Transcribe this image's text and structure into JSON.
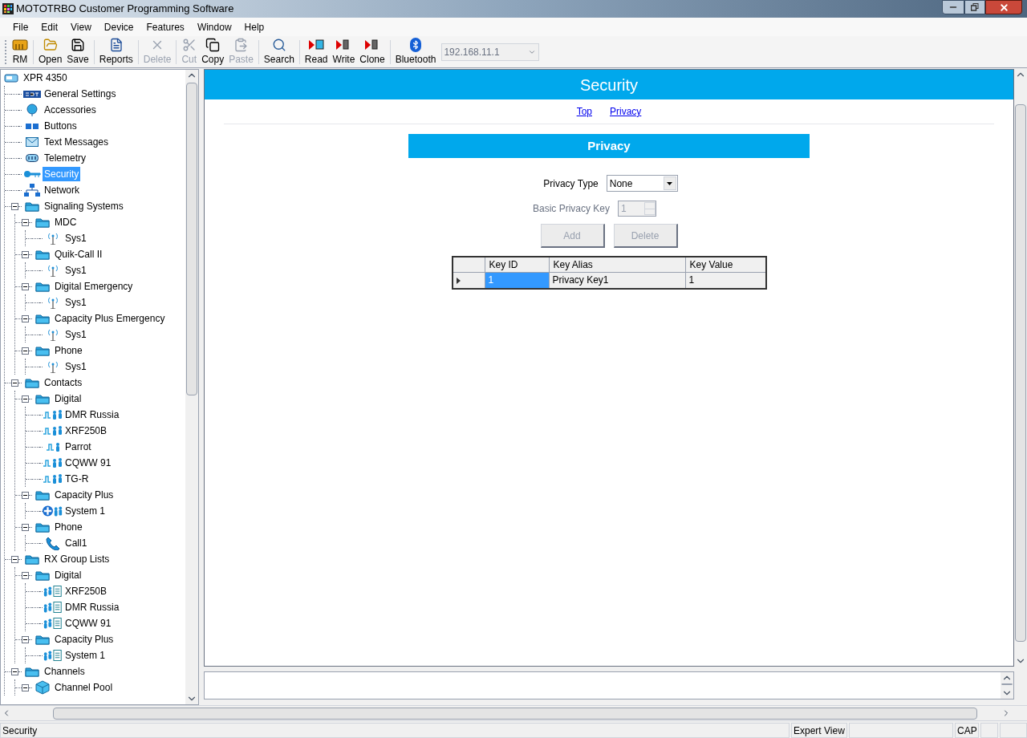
{
  "window": {
    "title": "MOTOTRBO Customer Programming Software"
  },
  "menu": [
    "File",
    "Edit",
    "View",
    "Device",
    "Features",
    "Window",
    "Help"
  ],
  "toolbar": [
    {
      "buttons": [
        {
          "label": "RM",
          "kind": "rm",
          "disabled": false
        }
      ]
    },
    {
      "buttons": [
        {
          "label": "Open",
          "kind": "open",
          "disabled": false
        },
        {
          "label": "Save",
          "kind": "save",
          "disabled": false
        }
      ]
    },
    {
      "buttons": [
        {
          "label": "Reports",
          "kind": "reports",
          "disabled": false
        }
      ]
    },
    {
      "buttons": [
        {
          "label": "Delete",
          "kind": "delete",
          "disabled": true
        }
      ]
    },
    {
      "buttons": [
        {
          "label": "Cut",
          "kind": "cut",
          "disabled": true
        },
        {
          "label": "Copy",
          "kind": "copy",
          "disabled": false
        },
        {
          "label": "Paste",
          "kind": "paste",
          "disabled": true
        }
      ]
    },
    {
      "buttons": [
        {
          "label": "Search",
          "kind": "search",
          "disabled": false
        }
      ]
    },
    {
      "buttons": [
        {
          "label": "Read",
          "kind": "read",
          "disabled": false
        },
        {
          "label": "Write",
          "kind": "write",
          "disabled": false
        },
        {
          "label": "Clone",
          "kind": "clone",
          "disabled": false
        }
      ]
    },
    {
      "buttons": [
        {
          "label": "Bluetooth",
          "kind": "bluetooth",
          "disabled": false
        }
      ]
    }
  ],
  "address_combo": {
    "value": "192.168.11.1",
    "disabled": true
  },
  "tree": [
    {
      "label": "XPR 4350",
      "kind": "device",
      "selected": false,
      "children": [
        {
          "label": "General Settings",
          "kind": "settings",
          "selected": false
        },
        {
          "label": "Accessories",
          "kind": "accessory",
          "selected": false
        },
        {
          "label": "Buttons",
          "kind": "buttons",
          "selected": false
        },
        {
          "label": "Text Messages",
          "kind": "message",
          "selected": false
        },
        {
          "label": "Telemetry",
          "kind": "telemetry",
          "selected": false
        },
        {
          "label": "Security",
          "kind": "key",
          "selected": true
        },
        {
          "label": "Network",
          "kind": "network",
          "selected": false
        },
        {
          "label": "Signaling Systems",
          "kind": "folder",
          "selected": false,
          "expanded": true,
          "children": [
            {
              "label": "MDC",
              "kind": "folder",
              "selected": false,
              "expanded": true,
              "children": [
                {
                  "label": "Sys1",
                  "kind": "antenna",
                  "selected": false
                }
              ]
            },
            {
              "label": "Quik-Call II",
              "kind": "folder",
              "selected": false,
              "expanded": true,
              "children": [
                {
                  "label": "Sys1",
                  "kind": "antenna",
                  "selected": false
                }
              ]
            },
            {
              "label": "Digital Emergency",
              "kind": "folder",
              "selected": false,
              "expanded": true,
              "children": [
                {
                  "label": "Sys1",
                  "kind": "antenna",
                  "selected": false
                }
              ]
            },
            {
              "label": "Capacity Plus Emergency",
              "kind": "folder",
              "selected": false,
              "expanded": true,
              "children": [
                {
                  "label": "Sys1",
                  "kind": "antenna",
                  "selected": false
                }
              ]
            },
            {
              "label": "Phone",
              "kind": "folder",
              "selected": false,
              "expanded": true,
              "children": [
                {
                  "label": "Sys1",
                  "kind": "antenna",
                  "selected": false
                }
              ]
            }
          ]
        },
        {
          "label": "Contacts",
          "kind": "folder",
          "selected": false,
          "expanded": true,
          "children": [
            {
              "label": "Digital",
              "kind": "folder",
              "selected": false,
              "expanded": true,
              "children": [
                {
                  "label": "DMR Russia",
                  "kind": "group-call",
                  "selected": false
                },
                {
                  "label": "XRF250B",
                  "kind": "group-call",
                  "selected": false
                },
                {
                  "label": "Parrot",
                  "kind": "private-call",
                  "selected": false
                },
                {
                  "label": "CQWW 91",
                  "kind": "group-call",
                  "selected": false
                },
                {
                  "label": "TG-R",
                  "kind": "group-call",
                  "selected": false
                }
              ]
            },
            {
              "label": "Capacity Plus",
              "kind": "folder",
              "selected": false,
              "expanded": true,
              "children": [
                {
                  "label": "System 1",
                  "kind": "capacity",
                  "selected": false
                }
              ]
            },
            {
              "label": "Phone",
              "kind": "folder",
              "selected": false,
              "expanded": true,
              "children": [
                {
                  "label": "Call1",
                  "kind": "phone",
                  "selected": false
                }
              ]
            }
          ]
        },
        {
          "label": "RX Group Lists",
          "kind": "folder",
          "selected": false,
          "expanded": true,
          "children": [
            {
              "label": "Digital",
              "kind": "folder",
              "selected": false,
              "expanded": true,
              "children": [
                {
                  "label": "XRF250B",
                  "kind": "rx-list",
                  "selected": false
                },
                {
                  "label": "DMR Russia",
                  "kind": "rx-list",
                  "selected": false
                },
                {
                  "label": "CQWW 91",
                  "kind": "rx-list",
                  "selected": false
                }
              ]
            },
            {
              "label": "Capacity Plus",
              "kind": "folder",
              "selected": false,
              "expanded": true,
              "children": [
                {
                  "label": "System 1",
                  "kind": "rx-list",
                  "selected": false
                }
              ]
            }
          ]
        },
        {
          "label": "Channels",
          "kind": "folder",
          "selected": false,
          "expanded": true,
          "children": [
            {
              "label": "Channel Pool",
              "kind": "cube",
              "selected": false,
              "expanded": true
            }
          ]
        }
      ]
    }
  ],
  "page": {
    "title": "Security",
    "links": [
      "Top",
      "Privacy"
    ],
    "section": "Privacy",
    "privacy_type": {
      "label": "Privacy Type",
      "value": "None",
      "disabled": false
    },
    "basic_privacy_key": {
      "label": "Basic Privacy Key",
      "value": "1",
      "disabled": true
    },
    "buttons": [
      {
        "label": "Add",
        "disabled": true
      },
      {
        "label": "Delete",
        "disabled": true
      }
    ],
    "table": {
      "columns": [
        "Key ID",
        "Key Alias",
        "Key Value"
      ],
      "rows": [
        {
          "current": true,
          "cells": [
            {
              "text": "1",
              "selected": true
            },
            {
              "text": "Privacy Key1",
              "selected": false
            },
            {
              "text": "1",
              "selected": false
            }
          ]
        }
      ]
    }
  },
  "status_bar": {
    "message": "Security",
    "view": "Expert View",
    "caps": "CAP"
  }
}
